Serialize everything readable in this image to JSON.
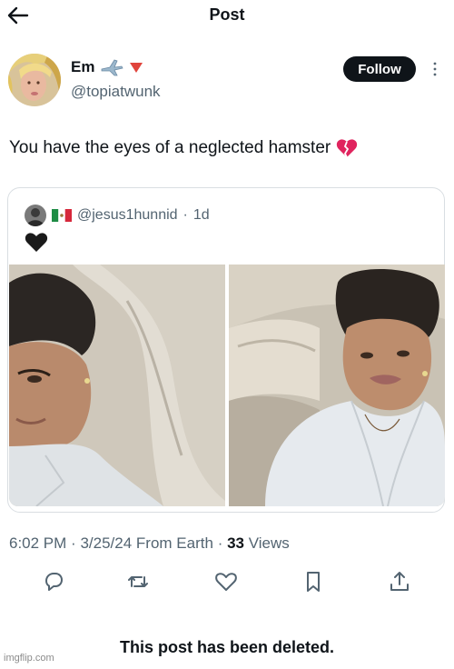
{
  "header": {
    "title": "Post",
    "back_icon": "arrow-left-icon"
  },
  "author": {
    "name": "Em",
    "handle": "@topiatwunk",
    "badges": [
      "airplane-emoji",
      "red-triangle-emoji"
    ],
    "follow_label": "Follow",
    "more_icon": "more-icon"
  },
  "post": {
    "text": "You have the eyes of a neglected hamster",
    "emoji": "💔"
  },
  "quoted": {
    "handle": "@jesus1hunnid",
    "separator": "·",
    "time": "1d",
    "flag": "mexico-flag",
    "text_emoji": "black-heart-emoji"
  },
  "meta": {
    "time": "6:02 PM",
    "date": "3/25/24",
    "source": "From Earth",
    "sep1": "·",
    "sep2": "·",
    "views_count": "33",
    "views_label": "Views"
  },
  "actions": [
    "reply-icon",
    "retweet-icon",
    "like-icon",
    "bookmark-icon",
    "share-icon"
  ],
  "footer": {
    "deleted_text": "This post has been deleted.",
    "watermark": "imgflip.com"
  },
  "colors": {
    "text": "#0f1419",
    "muted": "#536471",
    "border": "#d9dee2",
    "button_bg": "#0f1419",
    "broken_heart": "#e0245e"
  }
}
